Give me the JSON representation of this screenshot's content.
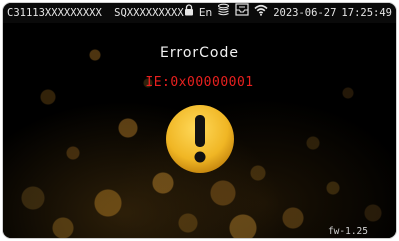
{
  "status_bar": {
    "device_id": "C31113XXXXXXXXX",
    "serial": "SQXXXXXXXXX",
    "language": "En",
    "date": "2023-06-27",
    "time": "17:25:49",
    "icons": [
      "lock-icon",
      "coin-stack-icon",
      "inbox-icon",
      "wifi-icon"
    ]
  },
  "main": {
    "title": "ErrorCode",
    "error_code": "IE:0x00000001",
    "icon": "warning-icon",
    "firmware": "fw-1.25"
  },
  "colors": {
    "error_text": "#e8201e",
    "warning_icon": "#f0b624",
    "background": "#000000"
  }
}
